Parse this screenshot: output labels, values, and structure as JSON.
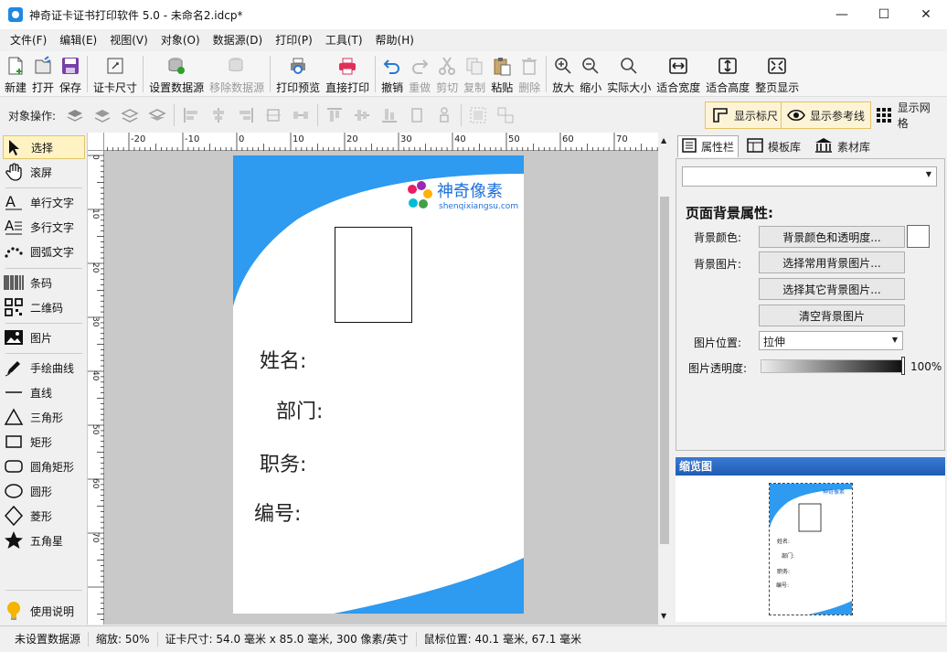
{
  "window": {
    "title": "神奇证卡证书打印软件 5.0 - 未命名2.idcp*",
    "minimize": "—",
    "maximize": "☐",
    "close": "✕"
  },
  "menu": [
    "文件(F)",
    "编辑(E)",
    "视图(V)",
    "对象(O)",
    "数据源(D)",
    "打印(P)",
    "工具(T)",
    "帮助(H)"
  ],
  "toolbar": [
    {
      "label": "新建",
      "icon": "new-file-icon",
      "enabled": true
    },
    {
      "label": "打开",
      "icon": "open-icon",
      "enabled": true
    },
    {
      "label": "保存",
      "icon": "save-icon",
      "enabled": true
    },
    {
      "label": "证卡尺寸",
      "icon": "card-size-icon",
      "enabled": true
    },
    {
      "label": "设置数据源",
      "icon": "database-icon",
      "enabled": true
    },
    {
      "label": "移除数据源",
      "icon": "database-remove-icon",
      "enabled": false
    },
    {
      "label": "打印预览",
      "icon": "print-preview-icon",
      "enabled": true
    },
    {
      "label": "直接打印",
      "icon": "printer-icon",
      "enabled": true
    },
    {
      "label": "撤销",
      "icon": "undo-icon",
      "enabled": true
    },
    {
      "label": "重做",
      "icon": "redo-icon",
      "enabled": false
    },
    {
      "label": "剪切",
      "icon": "cut-icon",
      "enabled": false
    },
    {
      "label": "复制",
      "icon": "copy-icon",
      "enabled": false
    },
    {
      "label": "粘贴",
      "icon": "paste-icon",
      "enabled": true
    },
    {
      "label": "删除",
      "icon": "delete-icon",
      "enabled": false
    },
    {
      "label": "放大",
      "icon": "zoom-in-icon",
      "enabled": true
    },
    {
      "label": "缩小",
      "icon": "zoom-out-icon",
      "enabled": true
    },
    {
      "label": "实际大小",
      "icon": "actual-size-icon",
      "enabled": true
    },
    {
      "label": "适合宽度",
      "icon": "fit-width-icon",
      "enabled": true
    },
    {
      "label": "适合高度",
      "icon": "fit-height-icon",
      "enabled": true
    },
    {
      "label": "整页显示",
      "icon": "fit-page-icon",
      "enabled": true
    }
  ],
  "objbar": {
    "label": "对象操作:",
    "toggles": [
      {
        "label": "显示标尺",
        "on": true
      },
      {
        "label": "显示参考线",
        "on": true
      },
      {
        "label": "显示网格",
        "on": false
      }
    ]
  },
  "tools": [
    {
      "label": "选择",
      "icon": "arrow-pointer-icon",
      "selected": true
    },
    {
      "label": "滚屏",
      "icon": "hand-icon"
    },
    {
      "label": "单行文字",
      "icon": "single-line-text-icon"
    },
    {
      "label": "多行文字",
      "icon": "multi-line-text-icon"
    },
    {
      "label": "圆弧文字",
      "icon": "arc-text-icon"
    },
    {
      "label": "条码",
      "icon": "barcode-icon"
    },
    {
      "label": "二维码",
      "icon": "qrcode-icon"
    },
    {
      "label": "图片",
      "icon": "image-icon"
    },
    {
      "label": "手绘曲线",
      "icon": "pen-icon"
    },
    {
      "label": "直线",
      "icon": "line-icon"
    },
    {
      "label": "三角形",
      "icon": "triangle-icon"
    },
    {
      "label": "矩形",
      "icon": "rectangle-icon"
    },
    {
      "label": "圆角矩形",
      "icon": "rounded-rectangle-icon"
    },
    {
      "label": "圆形",
      "icon": "circle-icon"
    },
    {
      "label": "菱形",
      "icon": "diamond-icon"
    },
    {
      "label": "五角星",
      "icon": "star-icon"
    },
    {
      "label": "使用说明",
      "icon": "lightbulb-icon"
    }
  ],
  "ruler": {
    "h_labels": [
      "-20",
      "-10",
      "0",
      "10",
      "20",
      "30",
      "40",
      "50",
      "60",
      "70"
    ],
    "v_labels": [
      "0",
      "10",
      "20",
      "30",
      "40",
      "50",
      "60",
      "70"
    ]
  },
  "card": {
    "logo_name": "神奇像素",
    "logo_url": "shenqixiangsu.com",
    "fields": [
      "姓名:",
      "部门:",
      "职务:",
      "编号:"
    ],
    "accent": "#2e9af0"
  },
  "right": {
    "tabs": [
      "属性栏",
      "模板库",
      "素材库"
    ],
    "section_title": "页面背景属性:",
    "bg_color_label": "背景颜色:",
    "bg_color_button": "背景颜色和透明度...",
    "bg_image_label": "背景图片:",
    "bg_image_button1": "选择常用背景图片...",
    "bg_image_button2": "选择其它背景图片...",
    "bg_image_clear": "清空背景图片",
    "img_pos_label": "图片位置:",
    "img_pos_value": "拉伸",
    "img_alpha_label": "图片透明度:",
    "img_alpha_value": "100%",
    "preview_title": "缩览图"
  },
  "status": {
    "datasource": "未设置数据源",
    "zoom": "缩放: 50%",
    "card_size": "证卡尺寸: 54.0 毫米 x 85.0 毫米, 300 像素/英寸",
    "mouse": "鼠标位置: 40.1 毫米, 67.1 毫米"
  }
}
